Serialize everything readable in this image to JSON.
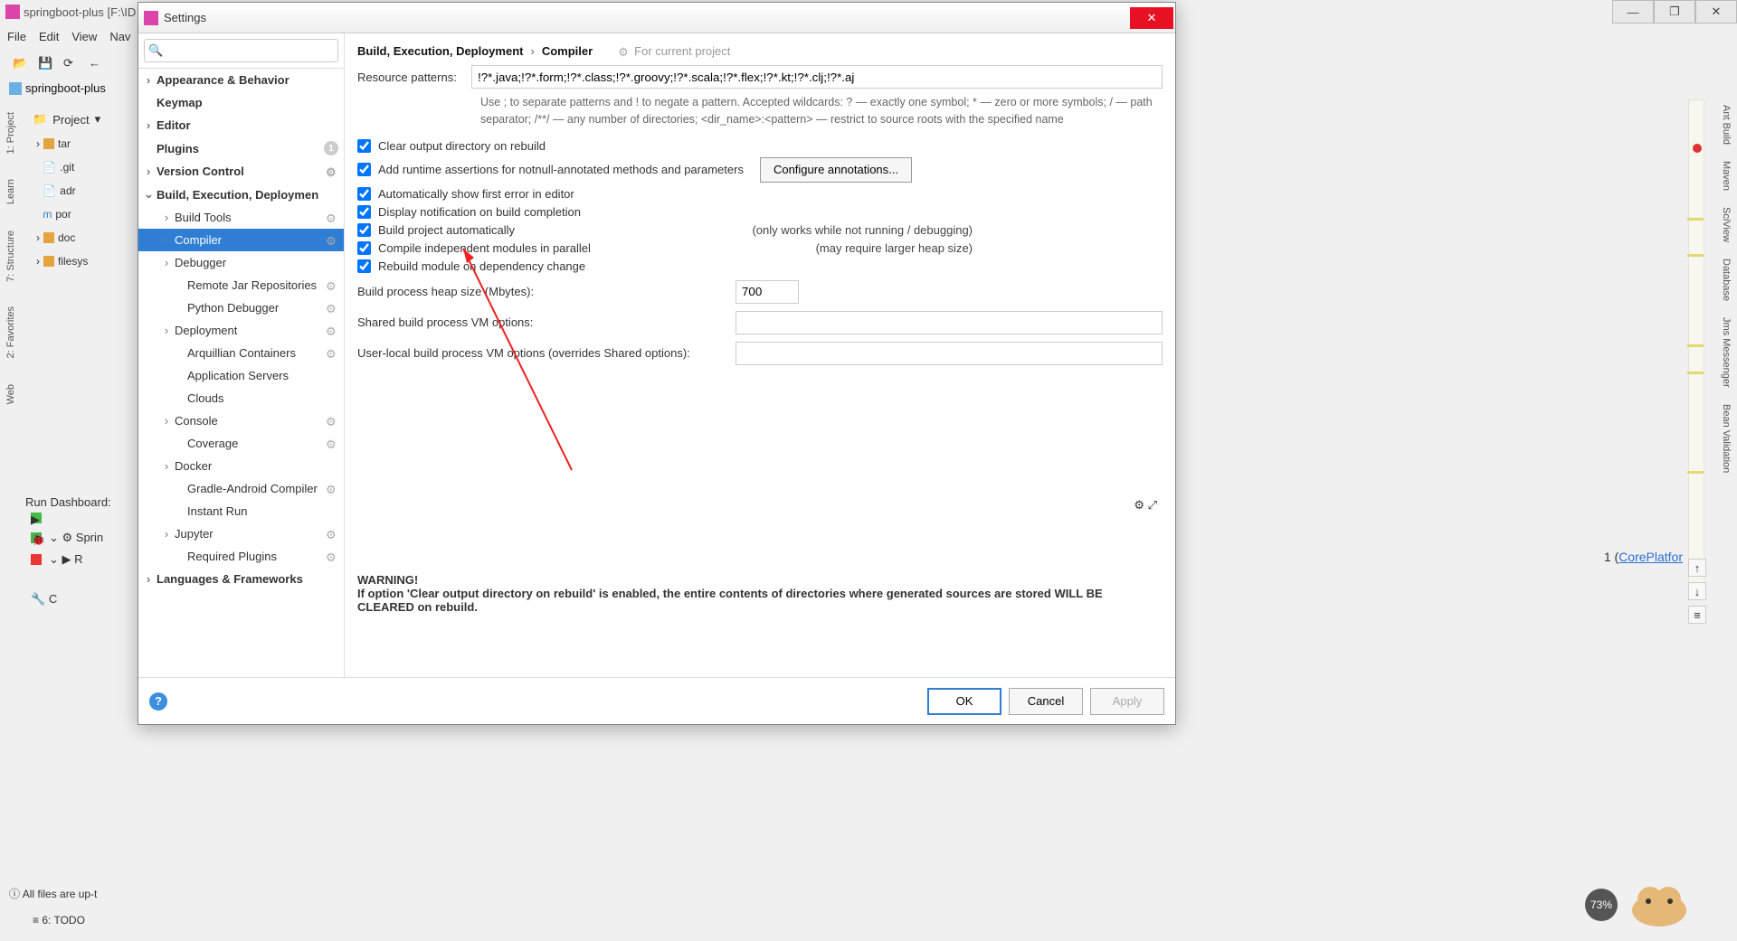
{
  "ide": {
    "title": "springboot-plus [F:\\ID",
    "menus": [
      "File",
      "Edit",
      "View",
      "Nav"
    ],
    "breadcrumb": "springboot-plus",
    "project_label": "Project",
    "leftTabs": [
      "1: Project",
      "Learn",
      "7: Structure",
      "2: Favorites",
      "Web"
    ],
    "tree": [
      "tar",
      ".git",
      "adr",
      "por",
      "doc",
      "filesys"
    ],
    "runDash": {
      "title": "Run Dashboard:",
      "items": [
        "Sprin",
        "R",
        "C"
      ]
    },
    "bottomTab": "6: TODO",
    "status": "All files are up-t",
    "rightTabs": [
      "Ant Build",
      "Maven",
      "SciView",
      "Database",
      "Jms Messenger",
      "Bean Validation"
    ],
    "codeHint": {
      "pre": "1 (",
      "link": "CorePlatfor"
    },
    "progress": "73%"
  },
  "win": {
    "min": "—",
    "max": "❐",
    "close": "✕"
  },
  "dialog": {
    "title": "Settings",
    "searchPlaceholder": "",
    "searchIcon": "🔍",
    "crumb": {
      "a": "Build, Execution, Deployment",
      "b": "Compiler",
      "proj": "For current project"
    },
    "tree": [
      {
        "label": "Appearance & Behavior",
        "chev": "›",
        "bold": true
      },
      {
        "label": "Keymap",
        "bold": true
      },
      {
        "label": "Editor",
        "chev": "›",
        "bold": true
      },
      {
        "label": "Plugins",
        "bold": true,
        "badge": "1"
      },
      {
        "label": "Version Control",
        "chev": "›",
        "bold": true,
        "cog": true
      },
      {
        "label": "Build, Execution, Deploymen",
        "chev": "⌄",
        "bold": true,
        "expanded": true
      },
      {
        "label": "Build Tools",
        "chev": "›",
        "indent": 1,
        "cog": true
      },
      {
        "label": "Compiler",
        "chev": "›",
        "indent": 1,
        "cog": true,
        "selected": true
      },
      {
        "label": "Debugger",
        "chev": "›",
        "indent": 1
      },
      {
        "label": "Remote Jar Repositories",
        "indent": 2,
        "cog": true
      },
      {
        "label": "Python Debugger",
        "indent": 2,
        "cog": true
      },
      {
        "label": "Deployment",
        "chev": "›",
        "indent": 1,
        "cog": true
      },
      {
        "label": "Arquillian Containers",
        "indent": 2,
        "cog": true
      },
      {
        "label": "Application Servers",
        "indent": 2
      },
      {
        "label": "Clouds",
        "indent": 2
      },
      {
        "label": "Console",
        "chev": "›",
        "indent": 1,
        "cog": true
      },
      {
        "label": "Coverage",
        "indent": 2,
        "cog": true
      },
      {
        "label": "Docker",
        "chev": "›",
        "indent": 1
      },
      {
        "label": "Gradle-Android Compiler",
        "indent": 2,
        "cog": true
      },
      {
        "label": "Instant Run",
        "indent": 2
      },
      {
        "label": "Jupyter",
        "chev": "›",
        "indent": 1,
        "cog": true
      },
      {
        "label": "Required Plugins",
        "indent": 2,
        "cog": true
      },
      {
        "label": "Languages & Frameworks",
        "chev": "›",
        "bold": true
      }
    ],
    "form": {
      "resourceLabel": "Resource patterns:",
      "resourceValue": "!?*.java;!?*.form;!?*.class;!?*.groovy;!?*.scala;!?*.flex;!?*.kt;!?*.clj;!?*.aj",
      "help": "Use ; to separate patterns and ! to negate a pattern. Accepted wildcards: ? — exactly one symbol; * — zero or more symbols; / — path separator; /**/ — any number of directories; <dir_name>:<pattern> — restrict to source roots with the specified name",
      "chk": [
        {
          "label": "Clear output directory on rebuild",
          "checked": true
        },
        {
          "label": "Add runtime assertions for notnull-annotated methods and parameters",
          "checked": true,
          "button": "Configure annotations..."
        },
        {
          "label": "Automatically show first error in editor",
          "checked": true
        },
        {
          "label": "Display notification on build completion",
          "checked": true
        },
        {
          "label": "Build project automatically",
          "checked": true,
          "note": "(only works while not running / debugging)"
        },
        {
          "label": "Compile independent modules in parallel",
          "checked": true,
          "note": "(may require larger heap size)"
        },
        {
          "label": "Rebuild module on dependency change",
          "checked": true
        }
      ],
      "heapLabel": "Build process heap size (Mbytes):",
      "heapValue": "700",
      "sharedLabel": "Shared build process VM options:",
      "sharedValue": "",
      "userLabel": "User-local build process VM options (overrides Shared options):",
      "userValue": "",
      "warning": {
        "title": "WARNING!",
        "body": "If option 'Clear output directory on rebuild' is enabled, the entire contents of directories where generated sources are stored WILL BE CLEARED on rebuild."
      }
    },
    "buttons": {
      "ok": "OK",
      "cancel": "Cancel",
      "apply": "Apply",
      "help": "?"
    }
  }
}
